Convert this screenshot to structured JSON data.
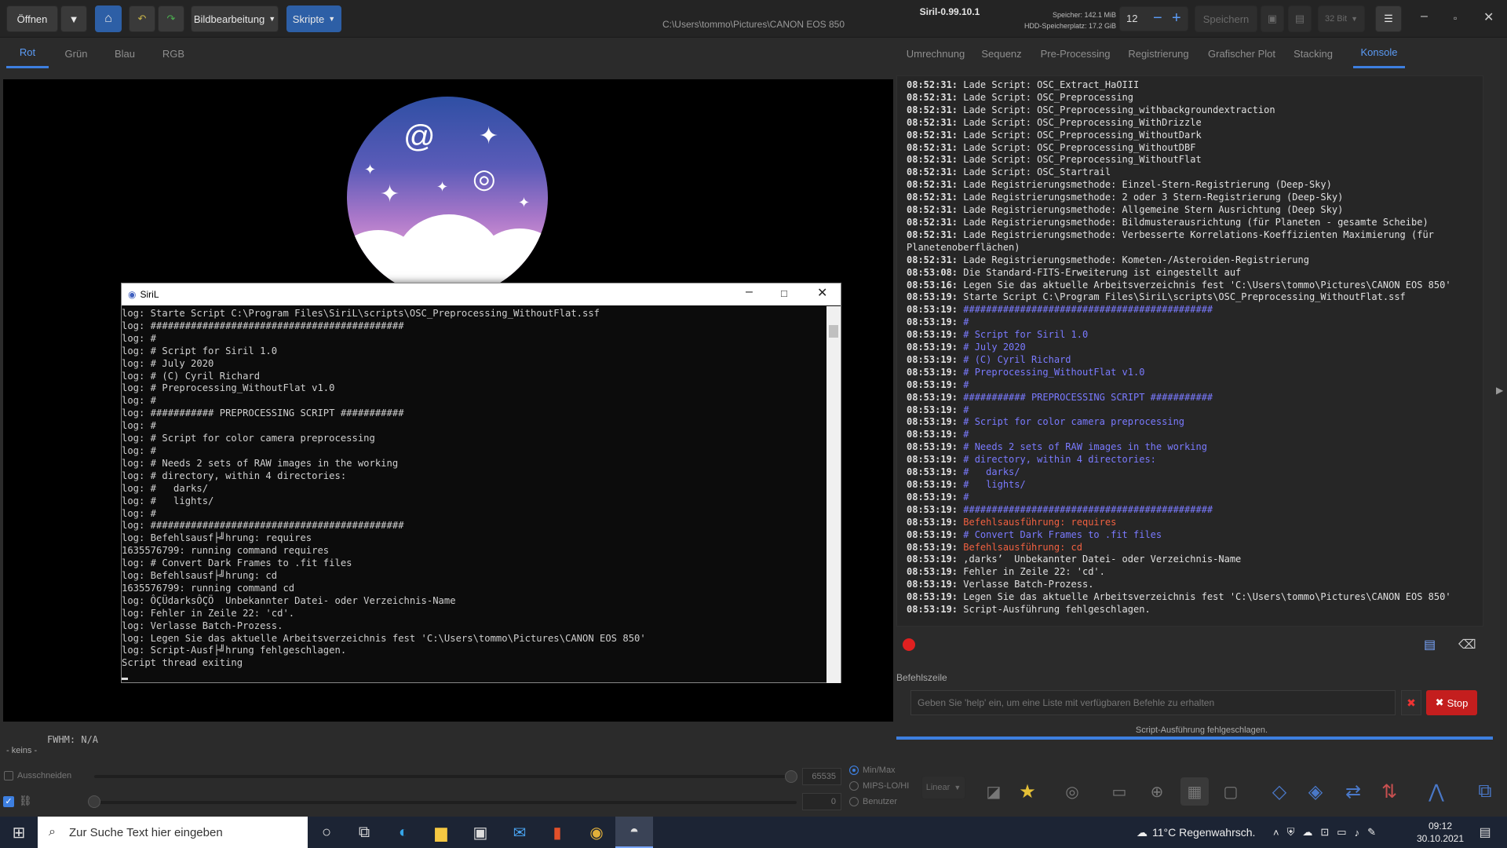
{
  "header": {
    "open_label": "Öffnen",
    "image_processing_label": "Bildbearbeitung",
    "scripts_label": "Skripte",
    "app_title": "Siril-0.99.10.1",
    "file_path": "C:\\Users\\tommo\\Pictures\\CANON EOS 850",
    "memory_label": "Speicher: 142.1 MiB",
    "disk_label": "HDD-Speicherplatz: 17.2 GiB",
    "thread_count": "12",
    "save_label": "Speichern",
    "bitdepth_label": "32 Bit"
  },
  "left_tabs": [
    {
      "label": "Rot"
    },
    {
      "label": "Grün"
    },
    {
      "label": "Blau"
    },
    {
      "label": "RGB"
    }
  ],
  "fwhm": "FWHM: N/A",
  "status_left": "- keins -",
  "bottom": {
    "crop_label": "Ausschneiden",
    "max_value": "65535",
    "min_value": "0",
    "radio_minmax": "Min/Max",
    "radio_mips": "MIPS-LO/HI",
    "radio_user": "Benutzer",
    "scale_label": "Linear"
  },
  "right_tabs": [
    {
      "label": "Umrechnung"
    },
    {
      "label": "Sequenz"
    },
    {
      "label": "Pre-Processing"
    },
    {
      "label": "Registrierung"
    },
    {
      "label": "Grafischer Plot"
    },
    {
      "label": "Stacking"
    },
    {
      "label": "Konsole"
    }
  ],
  "console_lines": [
    {
      "t": "08:52:31:",
      "m": " Lade Script: OSC_Extract_HaOIII",
      "c": ""
    },
    {
      "t": "08:52:31:",
      "m": " Lade Script: OSC_Preprocessing",
      "c": ""
    },
    {
      "t": "08:52:31:",
      "m": " Lade Script: OSC_Preprocessing_withbackgroundextraction",
      "c": ""
    },
    {
      "t": "08:52:31:",
      "m": " Lade Script: OSC_Preprocessing_WithDrizzle",
      "c": ""
    },
    {
      "t": "08:52:31:",
      "m": " Lade Script: OSC_Preprocessing_WithoutDark",
      "c": ""
    },
    {
      "t": "08:52:31:",
      "m": " Lade Script: OSC_Preprocessing_WithoutDBF",
      "c": ""
    },
    {
      "t": "08:52:31:",
      "m": " Lade Script: OSC_Preprocessing_WithoutFlat",
      "c": ""
    },
    {
      "t": "08:52:31:",
      "m": " Lade Script: OSC_Startrail",
      "c": ""
    },
    {
      "t": "08:52:31:",
      "m": " Lade Registrierungsmethode: Einzel-Stern-Registrierung (Deep-Sky)",
      "c": ""
    },
    {
      "t": "08:52:31:",
      "m": " Lade Registrierungsmethode: 2 oder 3 Stern-Registrierung (Deep-Sky)",
      "c": ""
    },
    {
      "t": "08:52:31:",
      "m": " Lade Registrierungsmethode: Allgemeine Stern Ausrichtung (Deep Sky)",
      "c": ""
    },
    {
      "t": "08:52:31:",
      "m": " Lade Registrierungsmethode: Bildmusterausrichtung (für Planeten - gesamte Scheibe)",
      "c": ""
    },
    {
      "t": "08:52:31:",
      "m": " Lade Registrierungsmethode: Verbesserte Korrelations-Koeffizienten Maximierung (für",
      "c": ""
    },
    {
      "t": "",
      "m": "Planetenoberflächen)",
      "c": ""
    },
    {
      "t": "08:52:31:",
      "m": " Lade Registrierungsmethode: Kometen-/Asteroiden-Registrierung",
      "c": ""
    },
    {
      "t": "08:53:08:",
      "m": " Die Standard-FITS-Erweiterung ist eingestellt auf",
      "c": ""
    },
    {
      "t": "08:53:16:",
      "m": " Legen Sie das aktuelle Arbeitsverzeichnis fest 'C:\\Users\\tommo\\Pictures\\CANON EOS 850'",
      "c": ""
    },
    {
      "t": "08:53:19:",
      "m": " Starte Script C:\\Program Files\\SiriL\\scripts\\OSC_Preprocessing_WithoutFlat.ssf",
      "c": ""
    },
    {
      "t": "08:53:19:",
      "m": " ############################################",
      "c": "c"
    },
    {
      "t": "08:53:19:",
      "m": " #",
      "c": "c"
    },
    {
      "t": "08:53:19:",
      "m": " # Script for Siril 1.0",
      "c": "c"
    },
    {
      "t": "08:53:19:",
      "m": " # July 2020",
      "c": "c"
    },
    {
      "t": "08:53:19:",
      "m": " # (C) Cyril Richard",
      "c": "c"
    },
    {
      "t": "08:53:19:",
      "m": " # Preprocessing_WithoutFlat v1.0",
      "c": "c"
    },
    {
      "t": "08:53:19:",
      "m": " #",
      "c": "c"
    },
    {
      "t": "08:53:19:",
      "m": " ########### PREPROCESSING SCRIPT ###########",
      "c": "c"
    },
    {
      "t": "08:53:19:",
      "m": " #",
      "c": "c"
    },
    {
      "t": "08:53:19:",
      "m": " # Script for color camera preprocessing",
      "c": "c"
    },
    {
      "t": "08:53:19:",
      "m": " #",
      "c": "c"
    },
    {
      "t": "08:53:19:",
      "m": " # Needs 2 sets of RAW images in the working",
      "c": "c"
    },
    {
      "t": "08:53:19:",
      "m": " # directory, within 4 directories:",
      "c": "c"
    },
    {
      "t": "08:53:19:",
      "m": " #   darks/",
      "c": "c"
    },
    {
      "t": "08:53:19:",
      "m": " #   lights/",
      "c": "c"
    },
    {
      "t": "08:53:19:",
      "m": " #",
      "c": "c"
    },
    {
      "t": "08:53:19:",
      "m": " ############################################",
      "c": "c"
    },
    {
      "t": "08:53:19:",
      "m": " Befehlsausführung: requires",
      "c": "o"
    },
    {
      "t": "08:53:19:",
      "m": " # Convert Dark Frames to .fit files",
      "c": "c"
    },
    {
      "t": "08:53:19:",
      "m": " Befehlsausführung: cd",
      "c": "o"
    },
    {
      "t": "08:53:19:",
      "m": " ‚darks’  Unbekannter Datei- oder Verzeichnis-Name",
      "c": ""
    },
    {
      "t": "08:53:19:",
      "m": " Fehler in Zeile 22: 'cd'.",
      "c": ""
    },
    {
      "t": "08:53:19:",
      "m": " Verlasse Batch-Prozess.",
      "c": ""
    },
    {
      "t": "08:53:19:",
      "m": " Legen Sie das aktuelle Arbeitsverzeichnis fest 'C:\\Users\\tommo\\Pictures\\CANON EOS 850'",
      "c": ""
    },
    {
      "t": "08:53:19:",
      "m": " Script-Ausführung fehlgeschlagen.",
      "c": ""
    }
  ],
  "befehlszeile_label": "Befehlszeile",
  "cmd_placeholder": "Geben Sie 'help' ein, um eine Liste mit verfügbaren Befehle zu erhalten",
  "stop_label": "Stop",
  "console_status": "Script-Ausführung fehlgeschlagen.",
  "progress": 1.0,
  "cmd_window": {
    "title": "SiriL",
    "lines": [
      "log: Starte Script C:\\Program Files\\SiriL\\scripts\\OSC_Preprocessing_WithoutFlat.ssf",
      "log: ############################################",
      "log: #",
      "log: # Script for Siril 1.0",
      "log: # July 2020",
      "log: # (C) Cyril Richard",
      "log: # Preprocessing_WithoutFlat v1.0",
      "log: #",
      "log: ########### PREPROCESSING SCRIPT ###########",
      "log: #",
      "log: # Script for color camera preprocessing",
      "log: #",
      "log: # Needs 2 sets of RAW images in the working",
      "log: # directory, within 4 directories:",
      "log: #   darks/",
      "log: #   lights/",
      "log: #",
      "log: ############################################",
      "log: Befehlsausf├╝hrung: requires",
      "1635576799: running command requires",
      "log: # Convert Dark Frames to .fit files",
      "log: Befehlsausf├╝hrung: cd",
      "1635576799: running command cd",
      "log: ÔÇÜdarksÔÇÖ  Unbekannter Datei- oder Verzeichnis-Name",
      "log: Fehler in Zeile 22: 'cd'.",
      "log: Verlasse Batch-Prozess.",
      "log: Legen Sie das aktuelle Arbeitsverzeichnis fest 'C:\\Users\\tommo\\Pictures\\CANON EOS 850'",
      "log: Script-Ausf├╝hrung fehlgeschlagen.",
      "Script thread exiting"
    ]
  },
  "taskbar": {
    "search_placeholder": "Zur Suche Text hier eingeben",
    "weather": "11°C  Regenwahrsch.",
    "time": "09:12",
    "date": "30.10.2021"
  }
}
